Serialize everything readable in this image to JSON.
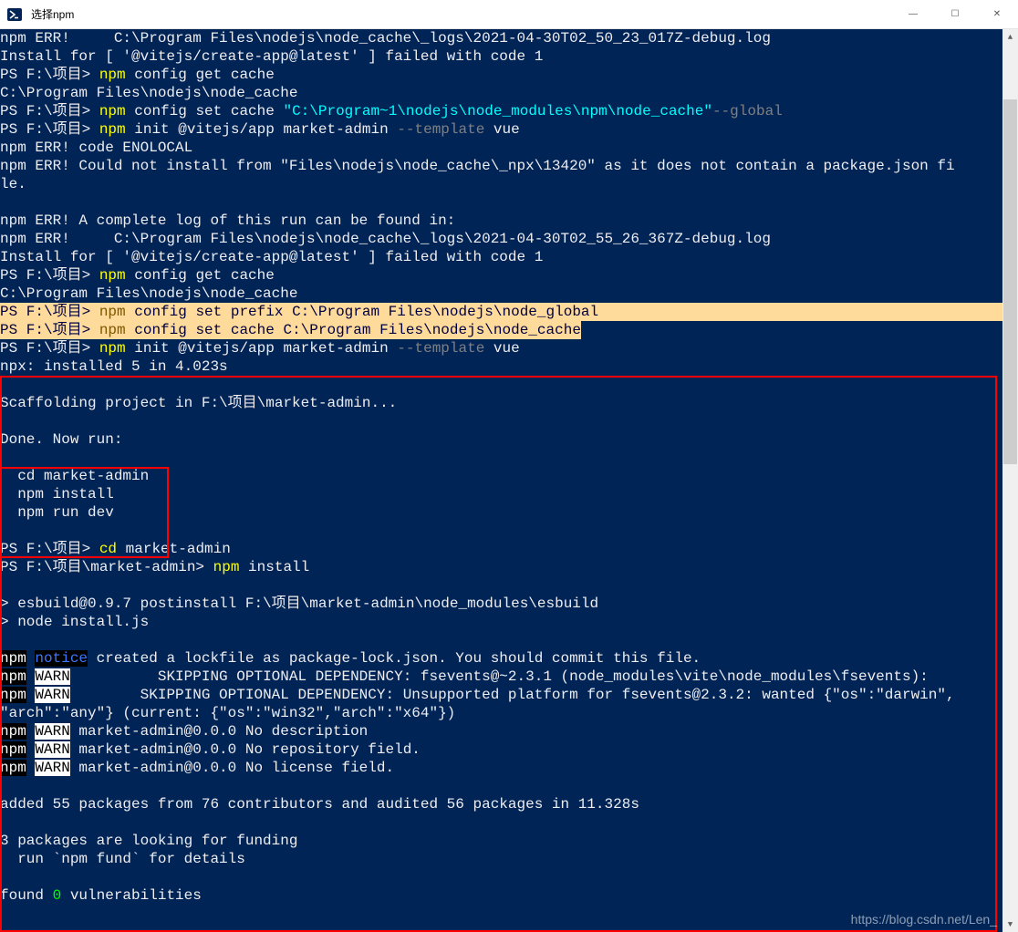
{
  "title": "选择npm",
  "sysbtns": {
    "min": "—",
    "max": "☐",
    "close": "✕"
  },
  "scroll": {
    "up": "▲",
    "down": "▼"
  },
  "lines": {
    "l01a": "npm ERR!",
    "l01b": "     C:\\Program Files\\nodejs\\node_cache\\_logs\\2021-04-30T02_50_23_017Z-debug.log",
    "l02": "Install for [ '@vitejs/create-app@latest' ] failed with code 1",
    "l03p": "PS F:\\项目> ",
    "l03c": "npm ",
    "l03r": "config get cache",
    "l04": "C:\\Program Files\\nodejs\\node_cache",
    "l05p": "PS F:\\项目> ",
    "l05c": "npm ",
    "l05r1": "config set cache ",
    "l05q": "\"C:\\Program~1\\nodejs\\node_modules\\npm\\node_cache\"",
    "l05g": "--global",
    "l06p": "PS F:\\项目> ",
    "l06c": "npm ",
    "l06r1": "init @vitejs/app market-admin ",
    "l06g": "--template",
    "l06r2": " vue",
    "l07": "npm ERR! code ENOLOCAL",
    "l08": "npm ERR! Could not install from \"Files\\nodejs\\node_cache\\_npx\\13420\" as it does not contain a package.json fi\nle.",
    "l09": "",
    "l10": "npm ERR! A complete log of this run can be found in:",
    "l11a": "npm ERR!",
    "l11b": "     C:\\Program Files\\nodejs\\node_cache\\_logs\\2021-04-30T02_55_26_367Z-debug.log",
    "l12": "Install for [ '@vitejs/create-app@latest' ] failed with code 1",
    "l13p": "PS F:\\项目> ",
    "l13c": "npm ",
    "l13r": "config get cache",
    "l14": "C:\\Program Files\\nodejs\\node_cache",
    "h1p": "PS F:\\项目> ",
    "h1c": "npm ",
    "h1r": "config set prefix C:\\Program Files\\nodejs\\node_global",
    "h1pad": "                                                  ",
    "h2p": "PS F:\\项目> ",
    "h2c": "npm ",
    "h2r": "config set cache C:\\Program Files\\nodejs\\node_cache",
    "l17p": "PS F:\\项目> ",
    "l17c": "npm ",
    "l17r1": "init @vitejs/app market-admin ",
    "l17g": "--template",
    "l17r2": " vue",
    "l18": "npx: installed 5 in 4.023s",
    "l19": "",
    "l20": "Scaffolding project in F:\\项目\\market-admin...",
    "l21": "",
    "l22": "Done. Now run:",
    "l23": "",
    "l24": "  cd market-admin",
    "l25": "  npm install",
    "l26": "  npm run dev",
    "l27": "",
    "l28p": "PS F:\\项目> ",
    "l28c": "cd ",
    "l28r": "market-admin",
    "l29p": "PS F:\\项目\\market-admin> ",
    "l29c": "npm ",
    "l29r": "install",
    "l30": "",
    "l31": "> esbuild@0.9.7 postinstall F:\\项目\\market-admin\\node_modules\\esbuild",
    "l32": "> node install.js",
    "l33": "",
    "npm": "npm",
    "notice": "notice",
    "warn": "WARN",
    "l34r": " created a lockfile as package-lock.json. You should commit this file.",
    "l35r": "          SKIPPING OPTIONAL DEPENDENCY: fsevents@~2.3.1 (node_modules\\vite\\node_modules\\fsevents):",
    "l36r": "        SKIPPING OPTIONAL DEPENDENCY: Unsupported platform for fsevents@2.3.2: wanted {\"os\":\"darwin\",\n\"arch\":\"any\"} (current: {\"os\":\"win32\",\"arch\":\"x64\"})",
    "l37r": " market-admin@0.0.0 No description",
    "l38r": " market-admin@0.0.0 No repository field.",
    "l39r": " market-admin@0.0.0 No license field.",
    "l40": "",
    "l41": "added 55 packages from 76 contributors and audited 56 packages in 11.328s",
    "l42": "",
    "l43": "3 packages are looking for funding",
    "l44": "  run `npm fund` for details",
    "l45": "",
    "l46a": "found ",
    "l46b": "0",
    "l46c": " vulnerabilities"
  },
  "watermark": "https://blog.csdn.net/Len_"
}
